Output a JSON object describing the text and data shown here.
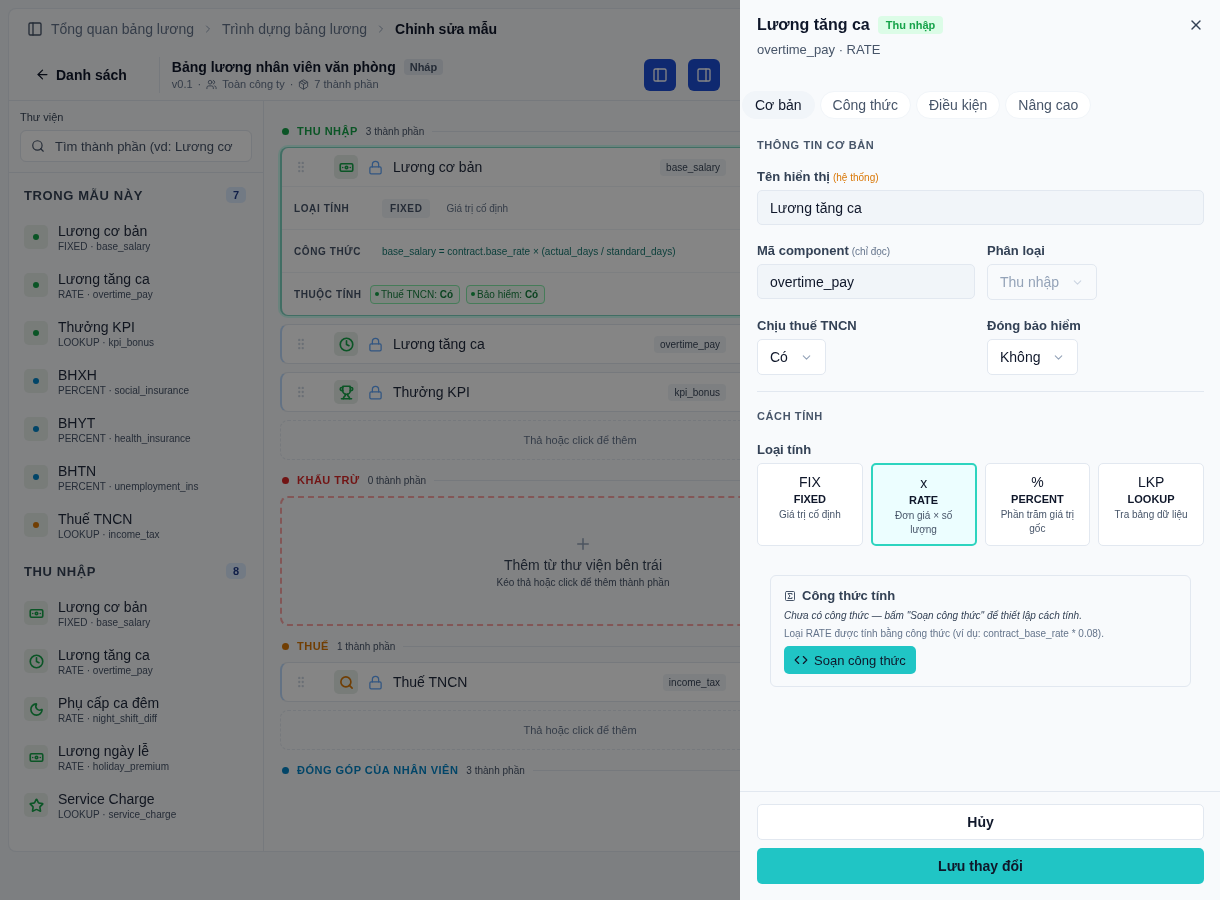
{
  "breadcrumb": [
    {
      "label": "Tổng quan bảng lương",
      "current": false
    },
    {
      "label": "Trình dựng bảng lương",
      "current": false
    },
    {
      "label": "Chỉnh sửa mẫu",
      "current": true
    }
  ],
  "toolbar": {
    "separator": "·",
    "back": "Danh sách",
    "title": "Bảng lương nhân viên văn phòng",
    "status": "Nháp",
    "version": "v0.1",
    "scope": "Toàn công ty",
    "count": "7 thành phần"
  },
  "library": {
    "label": "Thư viện",
    "search_placeholder": "Tìm thành phần (vd: Lương cơ",
    "groups": [
      {
        "title": "TRONG MẪU NÀY",
        "count": "7",
        "items": [
          {
            "name": "Lương cơ bản",
            "meta": "FIXED · base_salary",
            "kind": "dot",
            "color": "#0b5526"
          },
          {
            "name": "Lương tăng ca",
            "meta": "RATE · overtime_pay",
            "kind": "dot",
            "color": "#0b5526"
          },
          {
            "name": "Thưởng KPI",
            "meta": "LOOKUP · kpi_bonus",
            "kind": "dot",
            "color": "#0b5526"
          },
          {
            "name": "BHXH",
            "meta": "PERCENT · social_insurance",
            "kind": "dot",
            "color": "#014568"
          },
          {
            "name": "BHYT",
            "meta": "PERCENT · health_insurance",
            "kind": "dot",
            "color": "#014568"
          },
          {
            "name": "BHTN",
            "meta": "PERCENT · unemployment_ins",
            "kind": "dot",
            "color": "#014568"
          },
          {
            "name": "Thuế TNCN",
            "meta": "LOOKUP · income_tax",
            "kind": "dot",
            "color": "#713e03"
          }
        ]
      },
      {
        "title": "THU NHẬP",
        "count": "8",
        "items": [
          {
            "name": "Lương cơ bản",
            "meta": "FIXED · base_salary",
            "kind": "money",
            "color": "#0b5526"
          },
          {
            "name": "Lương tăng ca",
            "meta": "RATE · overtime_pay",
            "kind": "clock",
            "color": "#0b5526"
          },
          {
            "name": "Phụ cấp ca đêm",
            "meta": "RATE · night_shift_diff",
            "kind": "moon",
            "color": "#0b5526"
          },
          {
            "name": "Lương ngày lễ",
            "meta": "RATE · holiday_premium",
            "kind": "money",
            "color": "#0b5526"
          },
          {
            "name": "Service Charge",
            "meta": "LOOKUP · service_charge",
            "kind": "star",
            "color": "#0b5526"
          }
        ]
      }
    ]
  },
  "canvas": {
    "sections": [
      {
        "title": "THU NHẬP",
        "count": "3 thành phần",
        "color": "#0b5526",
        "drop_hint": "Thả hoặc click để thêm",
        "cards": [
          {
            "name": "Lương cơ bản",
            "code": "base_salary",
            "kind": "money",
            "color": "#0b5526",
            "expanded": true,
            "details": {
              "type_label": "LOẠI TÍNH",
              "type": "FIXED",
              "type_desc": "Giá trị cố định",
              "formula_label": "CÔNG THỨC",
              "formula": "base_salary = contract.base_rate × (actual_days / standard_days)",
              "attrs_label": "THUỘC TÍNH",
              "attrs": [
                "Thuế TNCN: **Có**",
                "Bảo hiểm: **Có**"
              ]
            }
          },
          {
            "name": "Lương tăng ca",
            "code": "overtime_pay",
            "kind": "clock",
            "color": "#0b5526",
            "expanded": false
          },
          {
            "name": "Thưởng KPI",
            "code": "kpi_bonus",
            "kind": "trophy",
            "color": "#0b5526",
            "expanded": false
          }
        ]
      },
      {
        "title": "KHẤU TRỪ",
        "count": "0 thành phần",
        "color": "#721414",
        "empty_title": "Thêm từ thư viện bên trái",
        "empty_hint": "Kéo thả hoặc click để thêm thành phần"
      },
      {
        "title": "THUẾ",
        "count": "1 thành phần",
        "color": "#713e03",
        "drop_hint": "Thả hoặc click để thêm",
        "cards": [
          {
            "name": "Thuế TNCN",
            "code": "income_tax",
            "kind": "search",
            "color": "#713e03",
            "expanded": false
          }
        ]
      },
      {
        "title": "ĐÓNG GÓP CỦA NHÂN VIÊN",
        "count": "3 thành phần",
        "color": "#014568"
      }
    ]
  },
  "drawer": {
    "title": "Lương tăng ca",
    "badge": "Thu nhập",
    "subtitle": "overtime_pay · RATE",
    "tabs": [
      {
        "label": "Cơ bản",
        "selected": true
      },
      {
        "label": "Công thức",
        "selected": false
      },
      {
        "label": "Điều kiện",
        "selected": false
      },
      {
        "label": "Nâng cao",
        "selected": false
      }
    ],
    "basic_section": "THÔNG TIN CƠ BẢN",
    "display_name": {
      "label": "Tên hiển thị",
      "note": "(hệ thống)",
      "value": "Lương tăng ca"
    },
    "code": {
      "label": "Mã component",
      "note": "(chỉ đọc)",
      "value": "overtime_pay"
    },
    "category": {
      "label": "Phân loại",
      "value": "Thu nhập",
      "disabled": true
    },
    "tax": {
      "label": "Chịu thuế TNCN",
      "value": "Có",
      "disabled": false
    },
    "insurance": {
      "label": "Đóng bảo hiểm",
      "value": "Không",
      "disabled": false
    },
    "calc_section": "CÁCH TÍNH",
    "calc_label": "Loại tính",
    "calc_types": [
      {
        "symbol": "FIX",
        "name": "FIXED",
        "desc": "Giá trị cố định",
        "selected": false
      },
      {
        "symbol": "x",
        "name": "RATE",
        "desc": "Đơn giá × số lượng",
        "selected": true
      },
      {
        "symbol": "%",
        "name": "PERCENT",
        "desc": "Phần trăm giá trị gốc",
        "selected": false
      },
      {
        "symbol": "LKP",
        "name": "LOOKUP",
        "desc": "Tra bảng dữ liệu",
        "selected": false
      }
    ],
    "formula": {
      "title": "Công thức tính",
      "empty_note": "Chưa có công thức — bấm \"Soạn công thức\" để thiết lập cách tính.",
      "hint": "Loại RATE được tính bằng công thức (ví dụ: contract_base_rate * 0.08).",
      "button": "Soạn công thức"
    },
    "footer": {
      "cancel": "Hủy",
      "save": "Lưu thay đổi"
    }
  }
}
